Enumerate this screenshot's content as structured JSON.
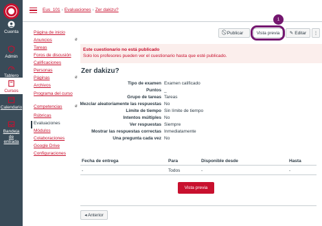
{
  "global_nav": {
    "items": [
      {
        "label": "Cuenta",
        "icon": "user-icon"
      },
      {
        "label": "Admin",
        "icon": "shield-icon"
      },
      {
        "label": "Tablero",
        "icon": "dashboard-icon"
      },
      {
        "label": "Cursos",
        "icon": "book-icon"
      },
      {
        "label": "Calendario",
        "icon": "calendar-icon"
      },
      {
        "label": "Bandeja de entrada",
        "icon": "inbox-icon"
      }
    ]
  },
  "breadcrumb": {
    "course": "Eus_101",
    "section": "Evaluaciones",
    "current": "Zer dakizu?"
  },
  "course_nav": {
    "items": [
      {
        "label": "Página de inicio"
      },
      {
        "label": "Anuncios",
        "hidden_icon": "ø"
      },
      {
        "label": "Tareas"
      },
      {
        "label": "Foros de discusión"
      },
      {
        "label": "Calificaciones"
      },
      {
        "label": "Personas"
      },
      {
        "label": "Páginas",
        "hidden_icon": "ø"
      },
      {
        "label": "Archivos"
      },
      {
        "label": "Programa del curso"
      },
      {
        "label": "Competencias",
        "hidden_icon": "ø"
      },
      {
        "label": "Rúbricas"
      },
      {
        "label": "Evaluaciones"
      },
      {
        "label": "Módulos"
      },
      {
        "label": "Colaboraciones"
      },
      {
        "label": "Google Drive"
      },
      {
        "label": "Configuraciones"
      }
    ]
  },
  "toolbar": {
    "publish": "Publicar",
    "preview": "Vista previa",
    "edit": "Editar",
    "more": "⋮"
  },
  "callout": {
    "number": "1"
  },
  "alert": {
    "title": "Este cuestionario no está publicado",
    "message": "Solo los profesores pueden ver el cuestionario hasta que esté publicado."
  },
  "quiz": {
    "title": "Zer dakizu?",
    "details": [
      {
        "key": "Tipo de examen",
        "value": "Examen calificado"
      },
      {
        "key": "Puntos",
        "value": "_"
      },
      {
        "key": "Grupo de tareas",
        "value": "Tareas"
      },
      {
        "key": "Mezclar aleatoriamente las respuestas",
        "value": "No"
      },
      {
        "key": "Límite de tiempo",
        "value": "Sin límite de tiempo"
      },
      {
        "key": "Intentos múltiples",
        "value": "No"
      },
      {
        "key": "Ver respuestas",
        "value": "Siempre"
      },
      {
        "key": "Mostrar las respuestas correctas",
        "value": "Inmediatamente"
      },
      {
        "key": "Una pregunta cada vez",
        "value": "No"
      }
    ]
  },
  "dates_table": {
    "headers": [
      "Fecha de entrega",
      "Para",
      "Disponible desde",
      "Hasta"
    ],
    "rows": [
      [
        "-",
        "Todos",
        "-",
        "-"
      ]
    ]
  },
  "preview_button": "Vista previa",
  "previous_button": "◂ Anterior",
  "colors": {
    "accent": "#c8102e",
    "nav_bg": "#394b58",
    "highlight": "#74176f"
  }
}
